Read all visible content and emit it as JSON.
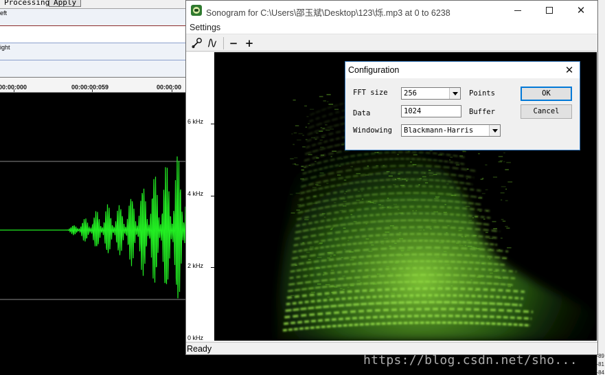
{
  "background_app": {
    "toolbar": {
      "processing_label": "Processing",
      "apply_label": "Apply"
    },
    "tracks": {
      "left_label": "eft",
      "right_label": "ight"
    },
    "timeline": {
      "times": [
        "00:00:000",
        "00:00:00:059",
        "00:00:00"
      ]
    },
    "right_strip_numbers": [
      "-89",
      "-81",
      "-84"
    ]
  },
  "sonogram": {
    "title": "Sonogram for C:\\Users\\邵玉斌\\Desktop\\123\\烁.mp3 at 0 to 6238",
    "menu": {
      "settings_label": "Settings"
    },
    "toolbar": {
      "settings_icon": "wrench-icon",
      "wave_icon": "wave-icon",
      "zoom_out_label": "−",
      "zoom_in_label": "+"
    },
    "axis": {
      "labels": [
        "6 kHz",
        "4 kHz",
        "2 kHz",
        "0 kHz"
      ]
    },
    "status": "Ready",
    "caption_buttons": {
      "close_glyph": "✕"
    }
  },
  "config": {
    "title": "Configuration",
    "close_glyph": "✕",
    "fft_size_label": "FFT size",
    "fft_size_value": "256",
    "points_label": "Points",
    "data_label": "Data",
    "data_value": "1024",
    "buffer_label": "Buffer",
    "windowing_label": "Windowing",
    "windowing_value": "Blackmann-Harris",
    "ok_label": "OK",
    "cancel_label": "Cancel"
  },
  "watermark": "https://blog.csdn.net/sho...",
  "colors": {
    "waveform": "#22ee22",
    "spectrogram_peak": "#9ae34a",
    "spectrogram_base": "#000000",
    "dialog_border": "#3c7fc4",
    "ok_focus": "#0078d7"
  }
}
